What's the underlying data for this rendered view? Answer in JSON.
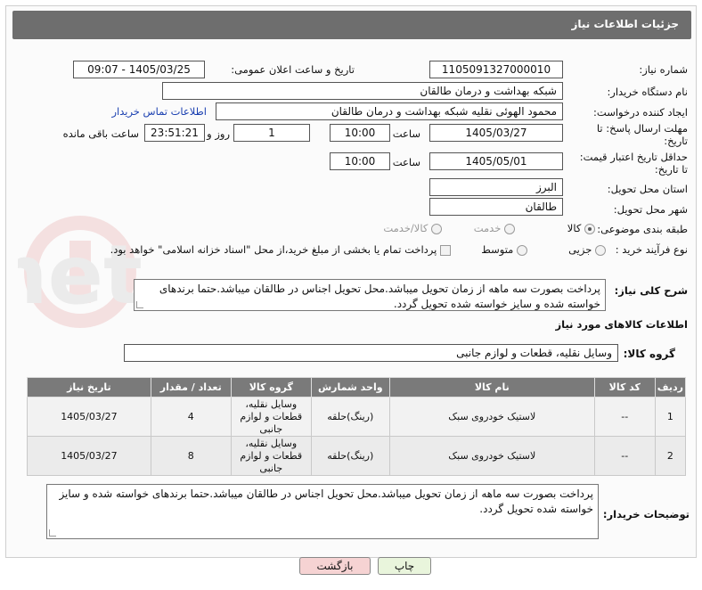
{
  "header": {
    "title": "جزئیات اطلاعات نیاز"
  },
  "fields": {
    "need_number_label": "شماره نیاز:",
    "need_number": "1105091327000010",
    "announce_label": "تاریخ و ساعت اعلان عمومی:",
    "announce_value": "1405/03/25 - 09:07",
    "buyer_org_label": "نام دستگاه خریدار:",
    "buyer_org": "شبکه بهداشت و درمان طالقان",
    "requester_label": "ایجاد کننده درخواست:",
    "requester": "محمود الهوئی نقلیه شبکه بهداشت و درمان طالقان",
    "buyer_contact_link": "اطلاعات تماس خریدار",
    "deadline_label_1": "مهلت ارسال پاسخ: تا",
    "deadline_label_2": "تاریخ:",
    "deadline_date": "1405/03/27",
    "time_label": "ساعت",
    "deadline_time": "10:00",
    "days_value": "1",
    "days_label": "روز و",
    "remaining_time": "23:51:21",
    "remaining_label": "ساعت باقی مانده",
    "validity_label_1": "حداقل تاریخ اعتبار قیمت:",
    "validity_label_2": "تا تاریخ:",
    "validity_date": "1405/05/01",
    "validity_time": "10:00",
    "province_label": "استان محل تحویل:",
    "province": "البرز",
    "city_label": "شهر محل تحویل:",
    "city": "طالقان",
    "category_label": "طبقه بندی موضوعی:",
    "category_goods": "کالا",
    "category_service": "خدمت",
    "category_goods_service": "کالا/خدمت",
    "process_label": "نوع فرآیند خرید :",
    "process_partial": "جزیی",
    "process_medium": "متوسط",
    "payment_note": "پرداخت تمام یا بخشی از مبلغ خرید،از محل \"اسناد خزانه اسلامی\" خواهد بود."
  },
  "description": {
    "label": "شرح کلی نیاز:",
    "text": "پرداخت بصورت سه ماهه از زمان تحویل میباشد.محل تحویل اجناس در طالقان میباشد.حتما برندهای خواسته شده و سایز خواسته شده تحویل گردد."
  },
  "goods_info": {
    "title": "اطلاعات کالاهای مورد نیاز",
    "group_label": "گروه کالا:",
    "group_value": "وسایل نقلیه، قطعات و لوازم جانبی"
  },
  "table": {
    "headers": [
      "ردیف",
      "کد کالا",
      "نام کالا",
      "واحد شمارش",
      "گروه کالا",
      "تعداد / مقدار",
      "تاریخ نیاز"
    ],
    "rows": [
      [
        "1",
        "--",
        "لاستیک خودروی سبک",
        "(رینگ)حلقه",
        "وسایل نقلیه، قطعات و لوازم جانبی",
        "4",
        "1405/03/27"
      ],
      [
        "2",
        "--",
        "لاستیک خودروی سبک",
        "(رینگ)حلقه",
        "وسایل نقلیه، قطعات و لوازم جانبی",
        "8",
        "1405/03/27"
      ]
    ]
  },
  "buyer_notes": {
    "label": "توضیحات خریدار:",
    "text": "پرداخت بصورت سه ماهه از زمان تحویل میباشد.محل تحویل اجناس در طالقان میباشد.حتما برندهای خواسته شده و سایز خواسته شده تحویل گردد."
  },
  "buttons": {
    "print": "چاپ",
    "back": "بازگشت"
  },
  "colors": {
    "header_bg": "#6e6e6e",
    "table_header_bg": "#7a7a7a",
    "back_button_bg": "#f6d3d3",
    "print_button_bg": "#e9f5dc",
    "link": "#1a3fb0"
  }
}
